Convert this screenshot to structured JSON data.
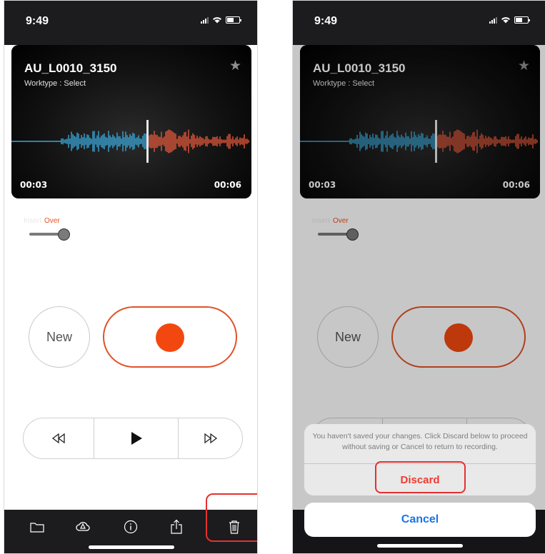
{
  "left_screen": {
    "status_time": "9:49",
    "card": {
      "title": "AU_L0010_3150",
      "worktype": "Worktype : Select",
      "time_start": "00:03",
      "time_end": "00:06",
      "played_color": "#3aa7d8",
      "remaining_color": "#e2583a"
    },
    "mode": {
      "insert_label": "Insert",
      "over_label": "Over",
      "selected": "Over"
    },
    "new_label": "New",
    "record_color": "#f2480f",
    "transport": [
      "rewind-icon",
      "play-icon",
      "fast-forward-icon"
    ],
    "bottom_icons": [
      "folder-icon",
      "cloud-sync-icon",
      "info-icon",
      "share-icon",
      "trash-icon"
    ],
    "highlight_color": "#e53030"
  },
  "right_screen": {
    "status_time": "9:49",
    "card": {
      "title": "AU_L0010_3150",
      "worktype": "Worktype : Select",
      "time_start": "00:03",
      "time_end": "00:06"
    },
    "mode": {
      "insert_label": "Insert",
      "over_label": "Over"
    },
    "new_label": "New",
    "dialog": {
      "message": "You haven't saved your changes. Click Discard below to proceed without saving or Cancel to return to recording.",
      "discard_label": "Discard",
      "cancel_label": "Cancel",
      "discard_color": "#ef3b2f",
      "cancel_color": "#1a73e8"
    }
  }
}
